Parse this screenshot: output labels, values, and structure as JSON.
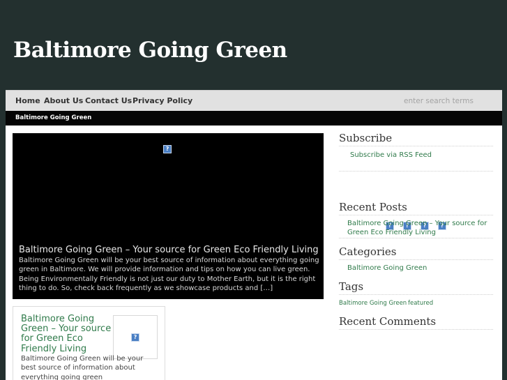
{
  "header": {
    "site_title": "Baltimore Going Green"
  },
  "nav": {
    "items": [
      "Home",
      "About Us",
      "Contact Us",
      "Privacy Policy"
    ],
    "search_placeholder": "enter search terms"
  },
  "breadcrumb": "Baltimore Going Green",
  "feature": {
    "image_icon": "broken-image-icon",
    "title": "Baltimore Going Green – Your source for Green Eco Friendly Living",
    "excerpt": "Baltimore Going Green will be your best source of information about everything going green in Baltimore.  We will provide information and tips on how you can live green.  Being Environmentally Friendly is not just our duty to Mother Earth, but it is the right thing to do.  So, check back frequently as we showcase products and […]"
  },
  "post": {
    "title": "Baltimore Going Green – Your source for Green Eco Friendly Living",
    "thumb_icon": "broken-image-icon",
    "excerpt": "Baltimore Going Green will be your best source of information about everything going green"
  },
  "sidebar": {
    "subscribe": {
      "title": "Subscribe",
      "rss_link": "Subscribe via RSS Feed"
    },
    "social_icons": [
      "broken-image-icon",
      "broken-image-icon",
      "broken-image-icon",
      "broken-image-icon"
    ],
    "recent_posts": {
      "title": "Recent Posts",
      "items": [
        "Baltimore Going Green – Your source for Green Eco Friendly Living"
      ]
    },
    "categories": {
      "title": "Categories",
      "items": [
        "Baltimore Going Green"
      ]
    },
    "tags": {
      "title": "Tags",
      "items": [
        "Baltimore Going Green",
        "featured"
      ]
    },
    "recent_comments": {
      "title": "Recent Comments"
    }
  },
  "colors": {
    "page_background": "#23302f",
    "link_green": "#2f7a4a",
    "nav_background": "#e1e1e1",
    "breadcrumb_background": "#050505",
    "feature_background": "#000000"
  }
}
